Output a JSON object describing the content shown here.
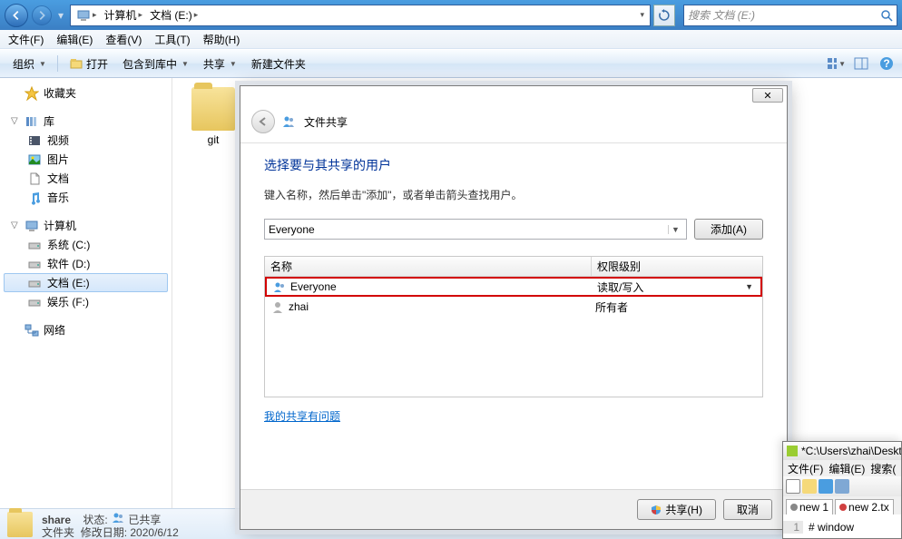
{
  "breadcrumb": {
    "seg1": "计算机",
    "seg2": "文档 (E:)"
  },
  "search": {
    "placeholder": "搜索 文档 (E:)"
  },
  "menu": {
    "file": "文件(F)",
    "edit": "编辑(E)",
    "view": "查看(V)",
    "tools": "工具(T)",
    "help": "帮助(H)"
  },
  "toolbar": {
    "organize": "组织",
    "open": "打开",
    "include": "包含到库中",
    "share": "共享",
    "newfolder": "新建文件夹"
  },
  "sidebar": {
    "favorites": "收藏夹",
    "libraries": "库",
    "lib": {
      "videos": "视频",
      "pictures": "图片",
      "documents": "文档",
      "music": "音乐"
    },
    "computer": "计算机",
    "drives": {
      "c": "系统 (C:)",
      "d": "软件 (D:)",
      "e": "文档 (E:)",
      "f": "娱乐 (F:)"
    },
    "network": "网络"
  },
  "content": {
    "folder1": "git"
  },
  "status": {
    "name": "share",
    "type": "文件夹",
    "state_label": "状态:",
    "state": "已共享",
    "modified_label": "修改日期:",
    "modified": "2020/6/12"
  },
  "dialog": {
    "caption": "文件共享",
    "title": "选择要与其共享的用户",
    "subtitle": "键入名称，然后单击\"添加\"，或者单击箭头查找用户。",
    "combo_value": "Everyone",
    "add": "添加(A)",
    "col_name": "名称",
    "col_perm": "权限级别",
    "rows": [
      {
        "name": "Everyone",
        "perm": "读取/写入",
        "dropdown": true
      },
      {
        "name": "zhai",
        "perm": "所有者",
        "dropdown": false
      }
    ],
    "trouble": "我的共享有问题",
    "share_btn": "共享(H)",
    "cancel_btn": "取消"
  },
  "npp": {
    "title": "*C:\\Users\\zhai\\Deskt",
    "menu": {
      "file": "文件(F)",
      "edit": "编辑(E)",
      "search": "搜索("
    },
    "tabs": {
      "t1": "new 1",
      "t2": "new 2.tx"
    },
    "line_no": "1",
    "code": "# window"
  }
}
